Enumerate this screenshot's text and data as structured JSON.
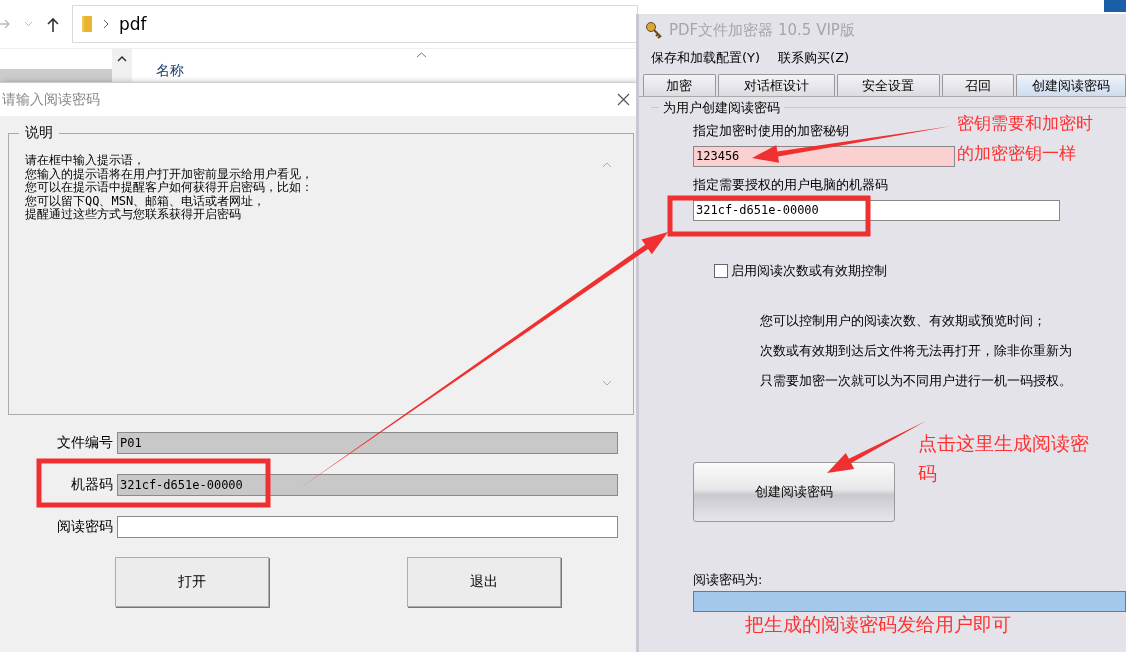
{
  "explorer": {
    "path": "pdf",
    "column_header": "名称"
  },
  "read_dialog": {
    "title": "请输入阅读密码",
    "group_title": "说明",
    "prompt_lines": [
      "请在框中输入提示语，",
      "您输入的提示语将在用户打开加密前显示给用户看见，",
      "您可以在提示语中提醒客户如何获得开启密码，比如：",
      "您可以留下QQ、MSN、邮箱、电话或者网址，",
      "提醒通过这些方式与您联系获得开启密码"
    ],
    "fields": [
      {
        "label": "文件编号",
        "value": "P01",
        "disabled": true
      },
      {
        "label": "机器码",
        "value": "321cf-d651e-00000",
        "disabled": true
      },
      {
        "label": "阅读密码",
        "disabled": false
      }
    ],
    "buttons": [
      "打开",
      "退出"
    ]
  },
  "main_window": {
    "title": "PDF文件加密器 10.5 VIP版",
    "menu": [
      "保存和加载配置(Y)",
      "联系购买(Z)"
    ],
    "tabs": [
      {
        "label": "加密",
        "selected": false
      },
      {
        "label": "对话框设计",
        "selected": false
      },
      {
        "label": "安全设置",
        "selected": false
      },
      {
        "label": "召回",
        "selected": false
      },
      {
        "label": "创建阅读密码",
        "selected": true
      }
    ],
    "group_title": "为用户创建阅读密码",
    "key_label": "指定加密时使用的加密秘钥",
    "key_value": "123456",
    "machine_label": "指定需要授权的用户电脑的机器码",
    "machine_value": "321cf-d651e-00000",
    "limit_checkbox": {
      "label": "启用阅读次数或有效期控制",
      "checked": false
    },
    "info_lines": [
      "您可以控制用户的阅读次数、有效期或预览时间；",
      "次数或有效期到达后文件将无法再打开，除非你重新为",
      "只需要加密一次就可以为不同用户进行一机一码授权。"
    ],
    "create_button": "创建阅读密码",
    "result_label": "阅读密码为:"
  },
  "annotations": [
    {
      "kind": "note",
      "text": "密钥需要和加密时的加密密钥一样"
    },
    {
      "kind": "note",
      "text": "点击这里生成阅读密码"
    },
    {
      "kind": "note",
      "text": "把生成的阅读密码发给用户即可"
    }
  ]
}
